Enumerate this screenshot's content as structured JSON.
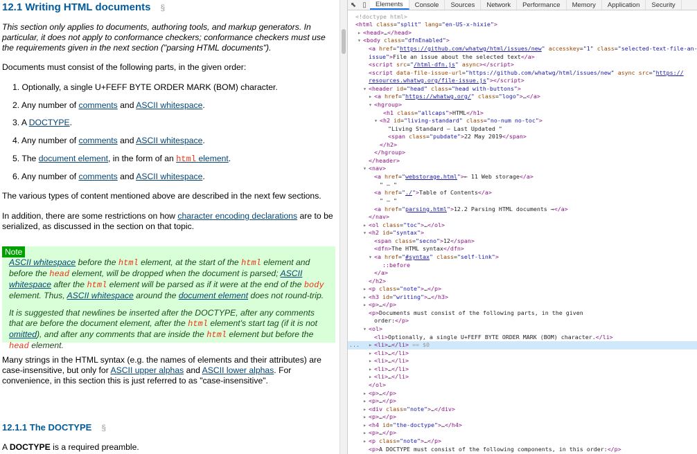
{
  "doc": {
    "heading": "12.1 Writing HTML documents",
    "section_sign": "§",
    "intro": "This section only applies to documents, authoring tools, and markup generators. In particular, it does not apply to conformance checkers; conformance checkers must use the requirements given in the next section (\"parsing HTML documents\").",
    "parts_lead": "Documents must consist of the following parts, in the given order:",
    "list": {
      "i1": "1. Optionally, a single U+FEFF BYTE ORDER MARK (BOM) character.",
      "num2": "2. Any number of ",
      "comments": "comments",
      "and": " and ",
      "ascii_ws": "ASCII whitespace",
      "period": ".",
      "num3": "3. A ",
      "doctype": "DOCTYPE",
      "num4": "4. Any number of ",
      "num5": "5. The ",
      "doc_element": "document element",
      "form": ", in the form of an ",
      "html": "html",
      "element": "element",
      "num6": "6. Any number of "
    },
    "various": "The various types of content mentioned above are described in the next few sections.",
    "restrict_a": "In addition, there are some restrictions on how ",
    "restrict_link": "character encoding declarations",
    "restrict_b": " are to be serialized, as discussed in the section on that topic.",
    "note": {
      "label": "Note",
      "p1": {
        "ws": "ASCII whitespace",
        "t1": " before the ",
        "html": "html",
        "t2": " element, at the start of the ",
        "t3": " element and before the ",
        "head": "head",
        "t4": " element, will be dropped when the document is parsed; ",
        "t5": " after the ",
        "t6": " element will be parsed as if it were at the end of the ",
        "body": "body",
        "t7": " element. Thus, ",
        "t8": " around the ",
        "docel": "document element",
        "t9": " does not round-trip."
      },
      "p2": {
        "t1": "It is suggested that newlines be inserted after the DOCTYPE, after any comments that are before the document element, after the ",
        "html": "html",
        "t2": " element's start tag (if it is not ",
        "omitted": "omitted",
        "t3": "), and after any comments that are inside the ",
        "t4": " element but before the ",
        "head": "head",
        "t5": " element."
      }
    },
    "many_a": "Many strings in the HTML syntax (e.g. the names of elements and their attributes) are case-insensitive, but only for ",
    "upper": "ASCII upper alphas",
    "many_and": " and ",
    "lower": "ASCII lower alphas",
    "many_b": ". For convenience, in this section this is just referred to as \"case-insensitive\".",
    "h4": "12.1.1 The DOCTYPE",
    "last_a": "A ",
    "last_b": "DOCTYPE",
    "last_c": " is a required preamble."
  },
  "devtools": {
    "tabs": [
      "Elements",
      "Console",
      "Sources",
      "Network",
      "Performance",
      "Memory",
      "Application",
      "Security"
    ],
    "active_tab": "Elements",
    "selected_suffix": " == $0",
    "gutter_dots": "..."
  },
  "colors": {
    "accent": "#1a73e8",
    "note_bg": "#d9ffd9",
    "note_tag": "#00a000",
    "heading": "#005a9c",
    "link": "#034575",
    "el_code": "#ee3311"
  }
}
